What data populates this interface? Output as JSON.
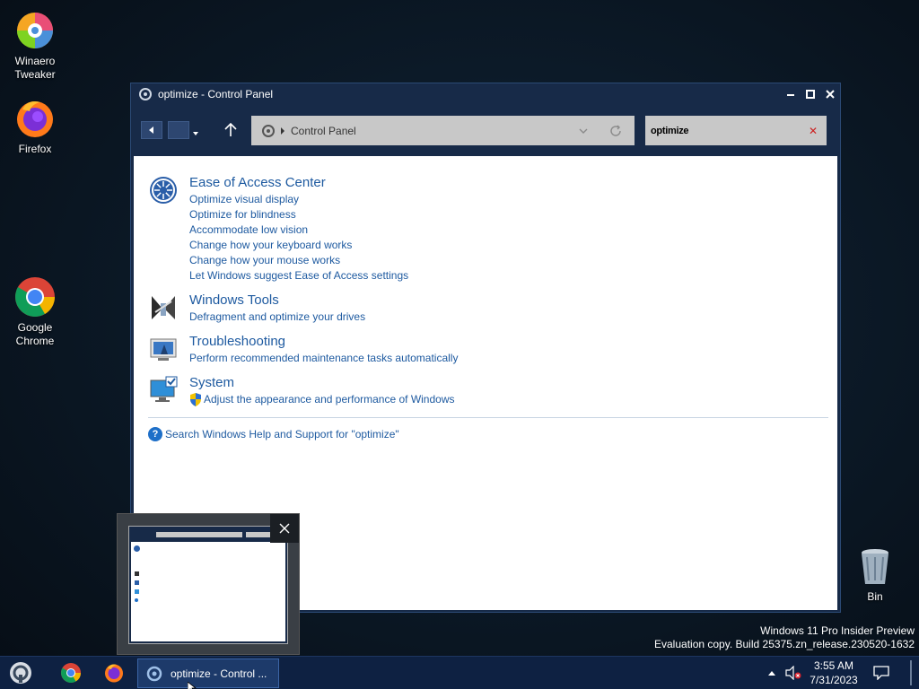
{
  "desktop": {
    "icons": [
      {
        "label_line1": "Winaero",
        "label_line2": "Tweaker"
      },
      {
        "label_line1": "Firefox",
        "label_line2": ""
      },
      {
        "label_line1": "Google",
        "label_line2": "Chrome"
      },
      {
        "label_line1": "Bin",
        "label_line2": ""
      }
    ],
    "watermark": {
      "line1": "Windows 11 Pro Insider Preview",
      "line2": "Evaluation copy. Build 25375.zn_release.230520-1632"
    }
  },
  "window": {
    "title": "optimize - Control Panel",
    "address": {
      "crumb": "Control Panel"
    },
    "search": {
      "query": "optimize"
    }
  },
  "results": {
    "groups": [
      {
        "title": "Ease of Access Center",
        "icon": "ease-of-access-icon",
        "links": [
          "Optimize visual display",
          "Optimize for blindness",
          "Accommodate low vision",
          "Change how your keyboard works",
          "Change how your mouse works",
          "Let Windows suggest Ease of Access settings"
        ]
      },
      {
        "title": "Windows Tools",
        "icon": "windows-tools-icon",
        "links": [
          "Defragment and optimize your drives"
        ]
      },
      {
        "title": "Troubleshooting",
        "icon": "troubleshooting-icon",
        "links": [
          "Perform recommended maintenance tasks automatically"
        ]
      },
      {
        "title": "System",
        "icon": "system-icon",
        "links": [
          "Adjust the appearance and performance of Windows"
        ]
      }
    ],
    "help_link": "Search Windows Help and Support for \"optimize\""
  },
  "taskbar": {
    "active_window_label": "optimize - Control ...",
    "time": "3:55 AM",
    "date": "7/31/2023"
  },
  "colors": {
    "link": "#1e5aa0",
    "window_frame": "#172a48",
    "taskbar": "#0e2142"
  }
}
